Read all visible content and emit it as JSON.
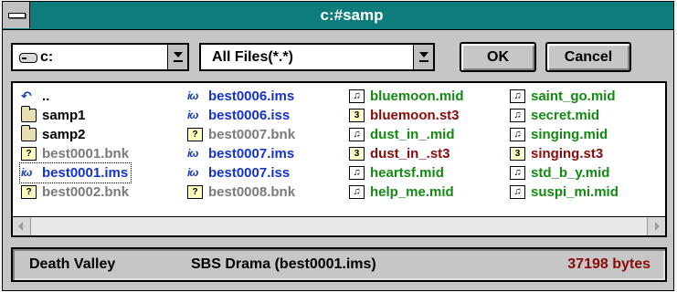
{
  "window": {
    "title": "c:#samp"
  },
  "drive_combo": {
    "value": "c:"
  },
  "filter_combo": {
    "value": "All Files(*.*)"
  },
  "buttons": {
    "ok": "OK",
    "cancel": "Cancel"
  },
  "columns": [
    [
      {
        "icon": "up-arrow-icon",
        "name": "..",
        "color": "black"
      },
      {
        "icon": "folder-icon",
        "name": "samp1",
        "color": "black"
      },
      {
        "icon": "folder-icon",
        "name": "samp2",
        "color": "black"
      },
      {
        "icon": "bnk-file-icon",
        "name": "best0001.bnk",
        "color": "gray"
      },
      {
        "icon": "ims-file-icon",
        "name": "best0001.ims",
        "color": "blue",
        "focused": true
      },
      {
        "icon": "bnk-file-icon",
        "name": "best0002.bnk",
        "color": "gray"
      }
    ],
    [
      {
        "icon": "ims-file-icon",
        "name": "best0006.ims",
        "color": "blue"
      },
      {
        "icon": "iss-file-icon",
        "name": "best0006.iss",
        "color": "blue"
      },
      {
        "icon": "bnk-file-icon",
        "name": "best0007.bnk",
        "color": "gray"
      },
      {
        "icon": "ims-file-icon",
        "name": "best0007.ims",
        "color": "blue"
      },
      {
        "icon": "iss-file-icon",
        "name": "best0007.iss",
        "color": "blue"
      },
      {
        "icon": "bnk-file-icon",
        "name": "best0008.bnk",
        "color": "gray"
      }
    ],
    [
      {
        "icon": "midi-file-icon",
        "name": "bluemoon.mid",
        "color": "green"
      },
      {
        "icon": "st3-file-icon",
        "name": "bluemoon.st3",
        "color": "red"
      },
      {
        "icon": "midi-file-icon",
        "name": "dust_in_.mid",
        "color": "green"
      },
      {
        "icon": "st3-file-icon",
        "name": "dust_in_.st3",
        "color": "red"
      },
      {
        "icon": "midi-file-icon",
        "name": "heartsf.mid",
        "color": "green"
      },
      {
        "icon": "midi-file-icon",
        "name": "help_me.mid",
        "color": "green"
      }
    ],
    [
      {
        "icon": "midi-file-icon",
        "name": "saint_go.mid",
        "color": "green"
      },
      {
        "icon": "midi-file-icon",
        "name": "secret.mid",
        "color": "green"
      },
      {
        "icon": "midi-file-icon",
        "name": "singing.mid",
        "color": "green"
      },
      {
        "icon": "st3-file-icon",
        "name": "singing.st3",
        "color": "red"
      },
      {
        "icon": "midi-file-icon",
        "name": "std_b_y.mid",
        "color": "green"
      },
      {
        "icon": "midi-file-icon",
        "name": "suspi_mi.mid",
        "color": "green"
      }
    ]
  ],
  "status": {
    "song": "Death Valley",
    "info": "SBS Drama  (best0001.ims)",
    "size": "37198 bytes",
    "size_color": "#8a0a0a"
  },
  "colors": {
    "title_bar": "#0f7c7c",
    "blue": "#1433cc",
    "green": "#128a12",
    "red": "#8a0a0a",
    "gray": "#7a7a7a"
  }
}
